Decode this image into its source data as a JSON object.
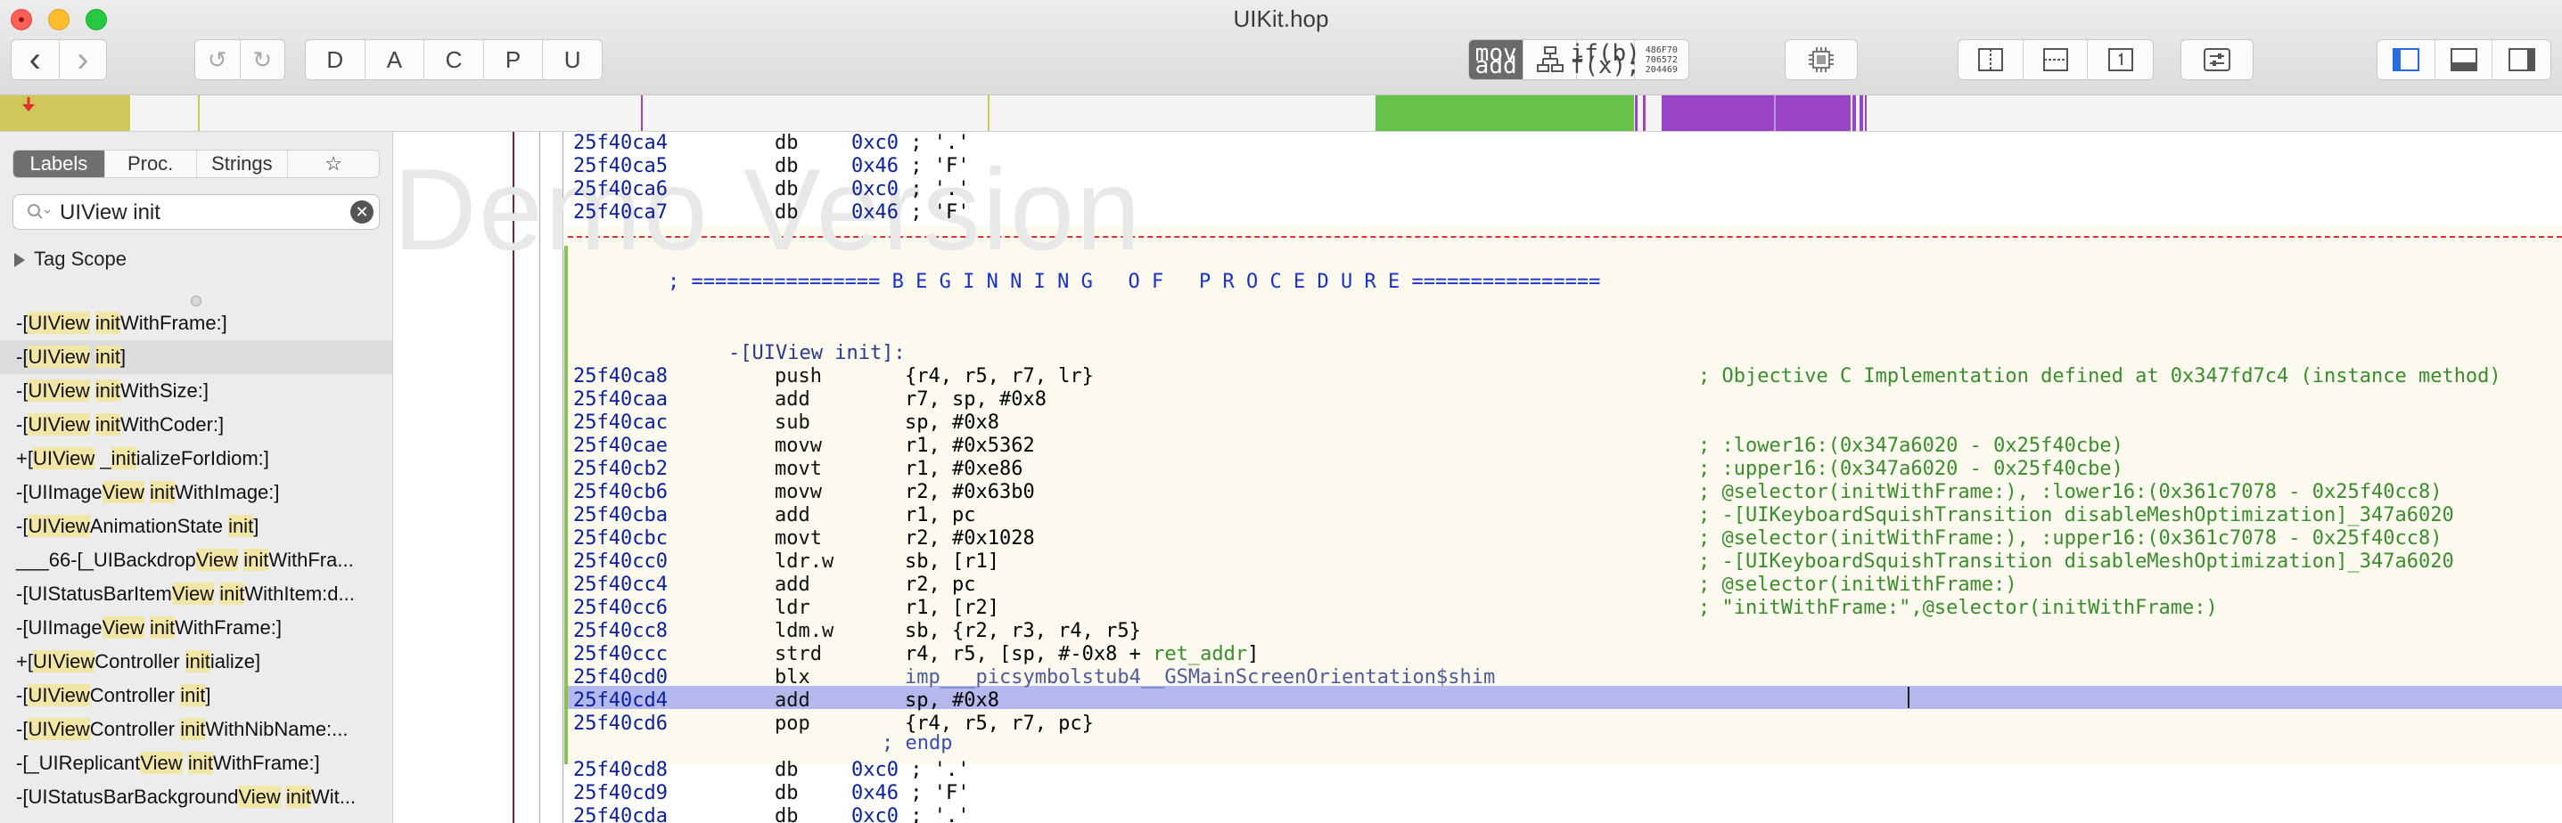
{
  "window": {
    "title": "UIKit.hop"
  },
  "toolbar": {
    "back": "‹",
    "forward": "›",
    "letters": [
      "D",
      "A",
      "C",
      "P",
      "U"
    ],
    "mode_asm_top": "mov",
    "mode_asm_bottom": "add",
    "mode_pseudo_top": "if(b)",
    "mode_pseudo_bottom": "f(x);",
    "mode_hex_top": "486F70",
    "mode_hex_mid": "706572",
    "mode_hex_bottom": "204469"
  },
  "sidebar": {
    "tabs": [
      "Labels",
      "Proc.",
      "Strings",
      "☆"
    ],
    "search_value": "UIView init",
    "tag_scope": "Tag Scope",
    "labels": [
      [
        {
          "t": "-["
        },
        {
          "t": "UIView",
          "h": 1
        },
        {
          "t": " "
        },
        {
          "t": "init",
          "h": 1
        },
        {
          "t": "WithFrame:]"
        }
      ],
      [
        {
          "t": "-["
        },
        {
          "t": "UIView",
          "h": 1
        },
        {
          "t": " "
        },
        {
          "t": "init",
          "h": 1
        },
        {
          "t": "]"
        }
      ],
      [
        {
          "t": "-["
        },
        {
          "t": "UIView",
          "h": 1
        },
        {
          "t": " "
        },
        {
          "t": "init",
          "h": 1
        },
        {
          "t": "WithSize:]"
        }
      ],
      [
        {
          "t": "-["
        },
        {
          "t": "UIView",
          "h": 1
        },
        {
          "t": " "
        },
        {
          "t": "init",
          "h": 1
        },
        {
          "t": "WithCoder:]"
        }
      ],
      [
        {
          "t": "+["
        },
        {
          "t": "UIView",
          "h": 1
        },
        {
          "t": " _"
        },
        {
          "t": "init",
          "h": 1
        },
        {
          "t": "ializeForIdiom:]"
        }
      ],
      [
        {
          "t": "-[UIImage"
        },
        {
          "t": "View",
          "h": 1
        },
        {
          "t": " "
        },
        {
          "t": "init",
          "h": 1
        },
        {
          "t": "WithImage:]"
        }
      ],
      [
        {
          "t": "-["
        },
        {
          "t": "UIView",
          "h": 1
        },
        {
          "t": "AnimationState "
        },
        {
          "t": "init",
          "h": 1
        },
        {
          "t": "]"
        }
      ],
      [
        {
          "t": "___66-[_UIBackdrop"
        },
        {
          "t": "View",
          "h": 1
        },
        {
          "t": " "
        },
        {
          "t": "init",
          "h": 1
        },
        {
          "t": "WithFra..."
        }
      ],
      [
        {
          "t": "-[UIStatusBarItem"
        },
        {
          "t": "View",
          "h": 1
        },
        {
          "t": " "
        },
        {
          "t": "init",
          "h": 1
        },
        {
          "t": "WithItem:d..."
        }
      ],
      [
        {
          "t": "-[UIImage"
        },
        {
          "t": "View",
          "h": 1
        },
        {
          "t": " "
        },
        {
          "t": "init",
          "h": 1
        },
        {
          "t": "WithFrame:]"
        }
      ],
      [
        {
          "t": "+["
        },
        {
          "t": "UIView",
          "h": 1
        },
        {
          "t": "Controller "
        },
        {
          "t": "init",
          "h": 1
        },
        {
          "t": "ialize]"
        }
      ],
      [
        {
          "t": "-["
        },
        {
          "t": "UIView",
          "h": 1
        },
        {
          "t": "Controller "
        },
        {
          "t": "init",
          "h": 1
        },
        {
          "t": "]"
        }
      ],
      [
        {
          "t": "-["
        },
        {
          "t": "UIView",
          "h": 1
        },
        {
          "t": "Controller "
        },
        {
          "t": "init",
          "h": 1
        },
        {
          "t": "WithNibName:..."
        }
      ],
      [
        {
          "t": "-[_UIReplicant"
        },
        {
          "t": "View",
          "h": 1
        },
        {
          "t": " "
        },
        {
          "t": "init",
          "h": 1
        },
        {
          "t": "WithFrame:]"
        }
      ],
      [
        {
          "t": "-[UIStatusBarBackground"
        },
        {
          "t": "View",
          "h": 1
        },
        {
          "t": " "
        },
        {
          "t": "init",
          "h": 1
        },
        {
          "t": "Wit..."
        }
      ]
    ]
  },
  "code": {
    "watermark": "Demo Version",
    "banner": "; ================ B E G I N N I N G   O F   P R O C E D U R E ================",
    "proc_name": "-[UIView init]:",
    "endp": "; endp",
    "lines": [
      {
        "a": "25f40ca4",
        "m": "db",
        "o": [
          [
            "0xc0",
            "blue"
          ],
          [
            " ; '.'",
            ""
          ]
        ]
      },
      {
        "a": "25f40ca5",
        "m": "db",
        "o": [
          [
            "0x46",
            "blue"
          ],
          [
            " ; 'F'",
            ""
          ]
        ]
      },
      {
        "a": "25f40ca6",
        "m": "db",
        "o": [
          [
            "0xc0",
            "blue"
          ],
          [
            " ; '.'",
            ""
          ]
        ]
      },
      {
        "a": "25f40ca7",
        "m": "db",
        "o": [
          [
            "0x46",
            "blue"
          ],
          [
            " ; 'F'",
            ""
          ]
        ]
      },
      {
        "a": "25f40ca8",
        "m": "push",
        "o": [
          [
            "{r4, r5, r7, lr}",
            ""
          ]
        ],
        "c": "; Objective C Implementation defined at 0x347fd7c4 (instance method)"
      },
      {
        "a": "25f40caa",
        "m": "add",
        "o": [
          [
            "r7, sp, #0x8",
            ""
          ]
        ]
      },
      {
        "a": "25f40cac",
        "m": "sub",
        "o": [
          [
            "sp, #0x8",
            ""
          ]
        ]
      },
      {
        "a": "25f40cae",
        "m": "movw",
        "o": [
          [
            "r1, #0x5362",
            ""
          ]
        ],
        "c": "; :lower16:(0x347a6020 - 0x25f40cbe)"
      },
      {
        "a": "25f40cb2",
        "m": "movt",
        "o": [
          [
            "r1, #0xe86",
            ""
          ]
        ],
        "c": "; :upper16:(0x347a6020 - 0x25f40cbe)"
      },
      {
        "a": "25f40cb6",
        "m": "movw",
        "o": [
          [
            "r2, #0x63b0",
            ""
          ]
        ],
        "c": "; @selector(initWithFrame:), :lower16:(0x361c7078 - 0x25f40cc8)"
      },
      {
        "a": "25f40cba",
        "m": "add",
        "o": [
          [
            "r1, pc",
            ""
          ]
        ],
        "c": "; -[UIKeyboardSquishTransition disableMeshOptimization]_347a6020"
      },
      {
        "a": "25f40cbc",
        "m": "movt",
        "o": [
          [
            "r2, #0x1028",
            ""
          ]
        ],
        "c": "; @selector(initWithFrame:), :upper16:(0x361c7078 - 0x25f40cc8)"
      },
      {
        "a": "25f40cc0",
        "m": "ldr.w",
        "o": [
          [
            "sb, [r1]",
            ""
          ]
        ],
        "c": "; -[UIKeyboardSquishTransition disableMeshOptimization]_347a6020"
      },
      {
        "a": "25f40cc4",
        "m": "add",
        "o": [
          [
            "r2, pc",
            ""
          ]
        ],
        "c": "; @selector(initWithFrame:)"
      },
      {
        "a": "25f40cc6",
        "m": "ldr",
        "o": [
          [
            "r1, [r2]",
            ""
          ]
        ],
        "c": "; \"initWithFrame:\",@selector(initWithFrame:)"
      },
      {
        "a": "25f40cc8",
        "m": "ldm.w",
        "o": [
          [
            "sb, {r2, r3, r4, r5}",
            ""
          ]
        ]
      },
      {
        "a": "25f40ccc",
        "m": "strd",
        "o": [
          [
            "r4, r5, [sp, #-0x8 + ",
            ""
          ],
          [
            "ret_addr",
            "green"
          ],
          [
            "]",
            ""
          ]
        ]
      },
      {
        "a": "25f40cd0",
        "m": "blx",
        "o": [
          [
            "imp___picsymbolstub4__GSMainScreenOrientation$shim",
            "imp"
          ]
        ]
      },
      {
        "a": "25f40cd4",
        "m": "add",
        "o": [
          [
            "sp, #0x8",
            ""
          ]
        ]
      },
      {
        "a": "25f40cd6",
        "m": "pop",
        "o": [
          [
            "{r4, r5, r7, pc}",
            ""
          ]
        ]
      },
      {
        "a": "25f40cd8",
        "m": "db",
        "o": [
          [
            "0xc0",
            "blue"
          ],
          [
            " ; '.'",
            ""
          ]
        ]
      },
      {
        "a": "25f40cd9",
        "m": "db",
        "o": [
          [
            "0x46",
            "blue"
          ],
          [
            " ; 'F'",
            ""
          ]
        ]
      },
      {
        "a": "25f40cda",
        "m": "db",
        "o": [
          [
            "0xc0",
            "blue"
          ],
          [
            " ; '.'",
            ""
          ]
        ]
      }
    ]
  },
  "colors": {
    "accent": "#0b1f9e",
    "comment": "#3b8c2c",
    "selection": "#b4b8ed",
    "navbar_yellow": "#cfc75a",
    "navbar_green": "#66c24a",
    "navbar_purple": "#9a44c8"
  }
}
